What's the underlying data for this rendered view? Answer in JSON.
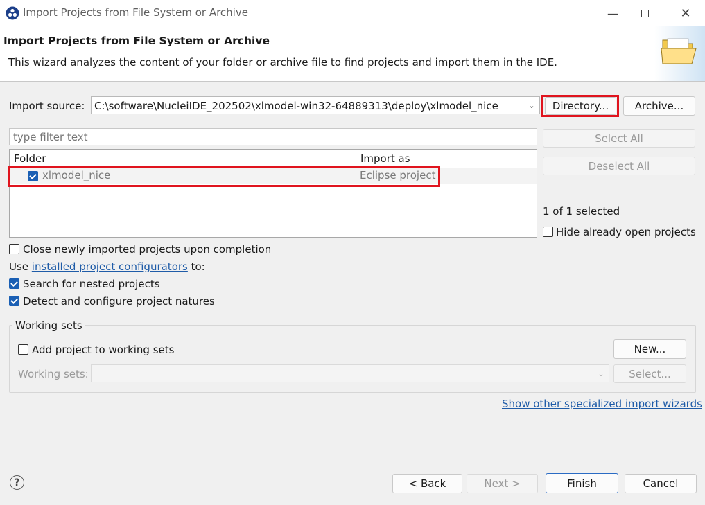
{
  "window": {
    "title": "Import Projects from File System or Archive"
  },
  "banner": {
    "title": "Import Projects from File System or Archive",
    "description": "This wizard analyzes the content of your folder or archive file to find projects and import them in the IDE."
  },
  "import_source": {
    "label": "Import source:",
    "value": "C:\\software\\NucleiIDE_202502\\xlmodel-win32-64889313\\deploy\\xlmodel_nice",
    "directory_button": "Directory...",
    "archive_button": "Archive..."
  },
  "filter": {
    "placeholder": "type filter text"
  },
  "table": {
    "columns": [
      "Folder",
      "Import as"
    ],
    "rows": [
      {
        "folder": "xlmodel_nice",
        "import_as": "Eclipse project",
        "checked": true
      }
    ]
  },
  "side": {
    "select_all": "Select All",
    "deselect_all": "Deselect All",
    "selected_count": "1 of 1 selected",
    "hide_open_label": "Hide already open projects"
  },
  "options": {
    "close_after_label": "Close newly imported projects upon completion",
    "use_prefix": "Use ",
    "configurators_link": "installed project configurators",
    "use_suffix": " to:",
    "nested_label": "Search for nested projects",
    "natures_label": "Detect and configure project natures"
  },
  "working_sets": {
    "group_label": "Working sets",
    "add_label": "Add project to working sets",
    "new_button": "New...",
    "sets_label": "Working sets:",
    "select_button": "Select..."
  },
  "other_wizards_link": "Show other specialized import wizards",
  "footer": {
    "back": "< Back",
    "next": "Next >",
    "finish": "Finish",
    "cancel": "Cancel"
  },
  "colors": {
    "highlight_red": "#e0141e",
    "checkbox_blue": "#1a5fb4",
    "link_blue": "#1f5ca8"
  }
}
